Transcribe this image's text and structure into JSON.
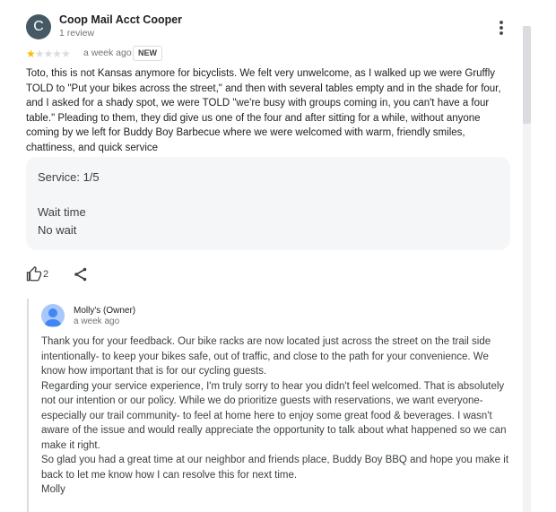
{
  "reviewer": {
    "initial": "C",
    "name": "Coop Mail Acct Cooper",
    "review_count": "1 review"
  },
  "rating": {
    "value": 1,
    "max": 5
  },
  "time": "a week ago",
  "badge": "NEW",
  "text": "Toto, this is not Kansas anymore for bicyclists. We felt very unwelcome, as I walked up we were Gruffly TOLD to \"Put your bikes across the street,\" and then with several tables empty and in the shade for four, and I asked for a shady spot, we were TOLD \"we're busy with groups coming in, you can't have a four table.\" Pleading to them, they did give us one of the four and after sitting for a while, without anyone coming by we left for Buddy Boy Barbecue where we were welcomed with warm, friendly smiles, chattiness, and quick service",
  "details": {
    "service": "Service: 1/5",
    "wait_label": "Wait time",
    "wait_value": "No wait"
  },
  "likes": "2",
  "owner_reply": {
    "name": "Molly's (Owner)",
    "time": "a week ago",
    "paragraphs": [
      "Thank you for your feedback. Our bike racks are now located just across the street on the trail side intentionally- to keep your bikes safe, out of traffic, and close to the path for your convenience. We know how important that is for our cycling guests.",
      "Regarding your service experience, I'm truly sorry to hear you didn't feel welcomed. That is absolutely not our intention or our policy. While we do prioritize guests with reservations, we want everyone-especially our trail community- to feel at home here to enjoy some great food & beverages. I wasn't aware of the issue and would really appreciate the opportunity to talk about what happened so we can make it right.",
      "So glad you had a great time at our neighbor and friends place, Buddy Boy BBQ and hope you make it back to let me know how I can resolve this for next time.",
      "Molly"
    ]
  },
  "colors": {
    "star_filled": "#fbbc04",
    "star_empty": "#dadce0",
    "details_bg": "#f5f6f7",
    "avatar_bg": "#455a64"
  },
  "icons": {
    "more": "more-vert-icon",
    "like": "thumb-up-icon",
    "share": "share-icon"
  }
}
